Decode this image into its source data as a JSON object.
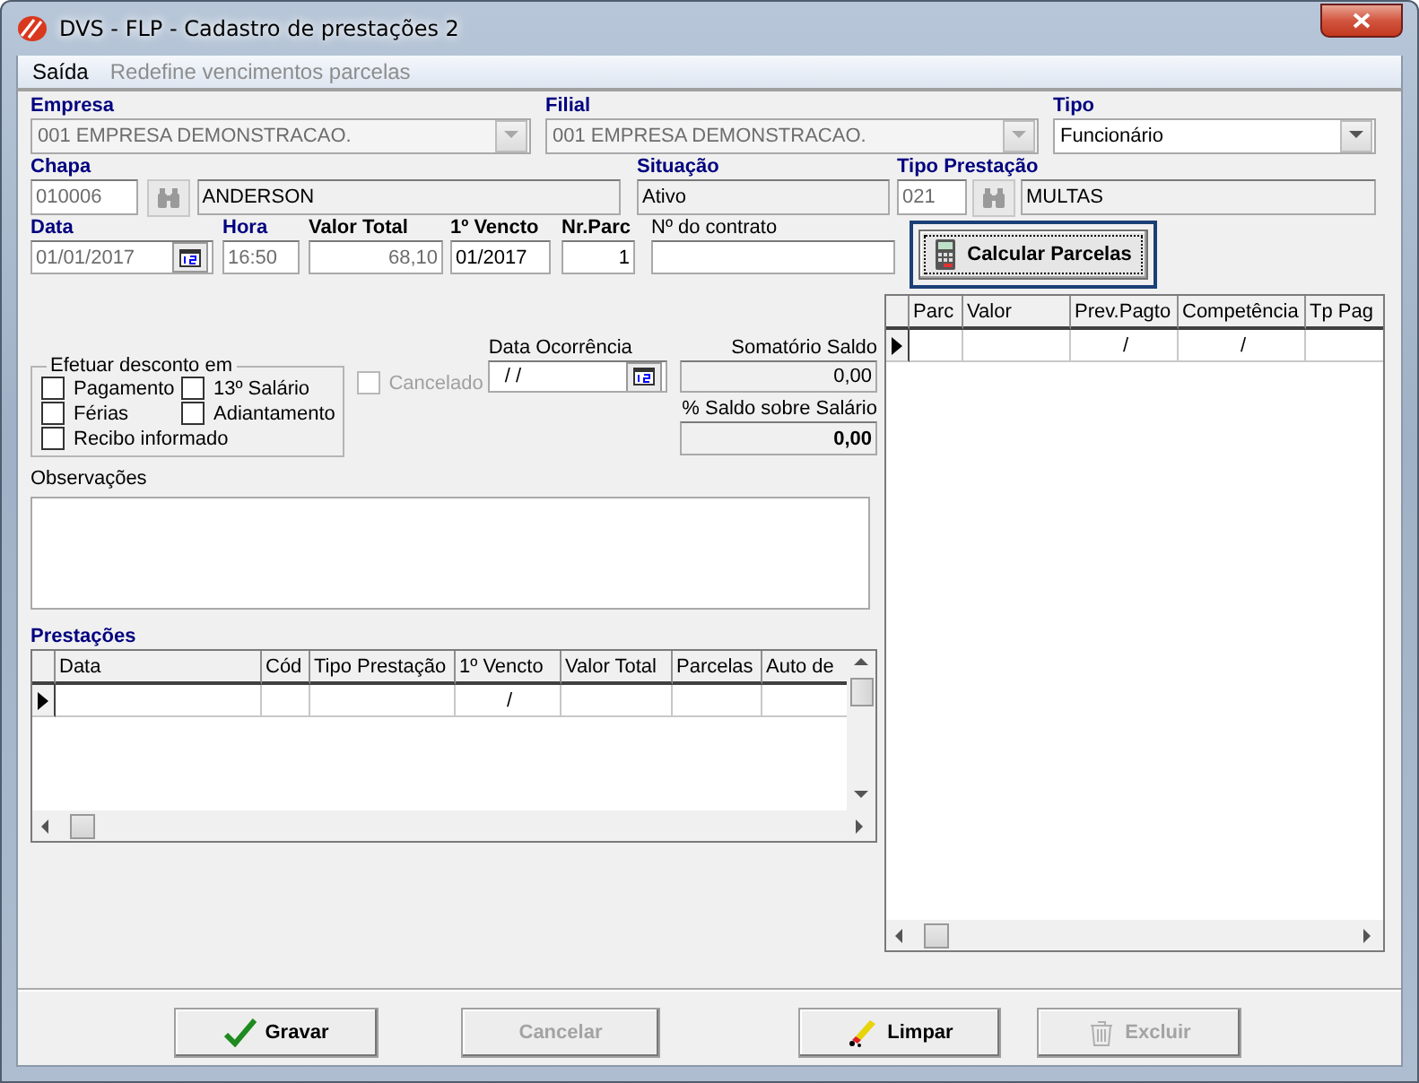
{
  "window": {
    "title": "DVS - FLP - Cadastro de prestações 2"
  },
  "menu": [
    {
      "label": "Saída",
      "disabled": false
    },
    {
      "label": "Redefine vencimentos parcelas",
      "disabled": true
    }
  ],
  "empresa": {
    "label": "Empresa",
    "required": true,
    "value": "001 EMPRESA DEMONSTRACAO.",
    "disabled": true
  },
  "filial": {
    "label": "Filial",
    "required": true,
    "value": "001 EMPRESA DEMONSTRACAO.",
    "disabled": true
  },
  "tipo": {
    "label": "Tipo",
    "required": true,
    "value": "Funcionário",
    "disabled": false
  },
  "chapa": {
    "label": "Chapa",
    "required": true,
    "code": "010006",
    "name": "ANDERSON"
  },
  "situacao": {
    "label": "Situação",
    "required": true,
    "value": "Ativo"
  },
  "tipo_prestacao": {
    "label": "Tipo Prestação",
    "required": true,
    "code": "021",
    "name": "MULTAS"
  },
  "data": {
    "label": "Data",
    "required": true,
    "value": "01/01/2017"
  },
  "hora": {
    "label": "Hora",
    "required": true,
    "value": "16:50"
  },
  "valor_total": {
    "label": "Valor Total",
    "required": false,
    "bold": true,
    "value": "68,10"
  },
  "primeiro_vencto": {
    "label": "1º Vencto",
    "required": false,
    "bold": true,
    "value": "01/2017"
  },
  "nr_parc": {
    "label": "Nr.Parc",
    "required": false,
    "bold": true,
    "value": "1"
  },
  "numero_contrato": {
    "label": "Nº do contrato",
    "required": false,
    "bold": false
  },
  "calcular_button": {
    "label": "Calcular Parcelas",
    "focused": true
  },
  "desconto": {
    "title": "Efetuar desconto em",
    "options": [
      {
        "label": "Pagamento",
        "checked": false
      },
      {
        "label": "13º Salário",
        "checked": false
      },
      {
        "label": "Férias",
        "checked": false
      },
      {
        "label": "Adiantamento",
        "checked": false
      },
      {
        "label": "Recibo informado",
        "checked": false
      }
    ]
  },
  "cancelado": {
    "label": "Cancelado",
    "checked": false,
    "disabled": true
  },
  "data_ocorrencia": {
    "label": "Data Ocorrência",
    "value": "/ /"
  },
  "somatorio_saldo": {
    "label": "Somatório Saldo",
    "value": "0,00"
  },
  "saldo_salario": {
    "label": "% Saldo sobre Salário",
    "value": "0,00"
  },
  "observacoes": {
    "label": "Observações"
  },
  "prestacoes": {
    "label": "Prestações",
    "columns": [
      "Data",
      "Cód",
      "Tipo Prestação",
      "1º Vencto",
      "Valor Total",
      "Parcelas",
      "Auto de"
    ],
    "rows": [
      {
        "current": true,
        "cells": [
          "",
          "",
          "",
          "/",
          "",
          "",
          ""
        ]
      }
    ]
  },
  "parcelas": {
    "columns": [
      "Parc",
      "Valor",
      "Prev.Pagto",
      "Competência",
      "Tp Pag"
    ],
    "rows": [
      {
        "current": true,
        "cells": [
          "",
          "",
          "/",
          "/",
          ""
        ]
      }
    ]
  },
  "buttons": [
    {
      "label": "Gravar",
      "kind": "check",
      "disabled": false
    },
    {
      "label": "Cancelar",
      "kind": "plain",
      "disabled": true
    },
    {
      "label": "Limpar",
      "kind": "eraser",
      "disabled": false
    },
    {
      "label": "Excluir",
      "kind": "trash",
      "disabled": true
    }
  ]
}
